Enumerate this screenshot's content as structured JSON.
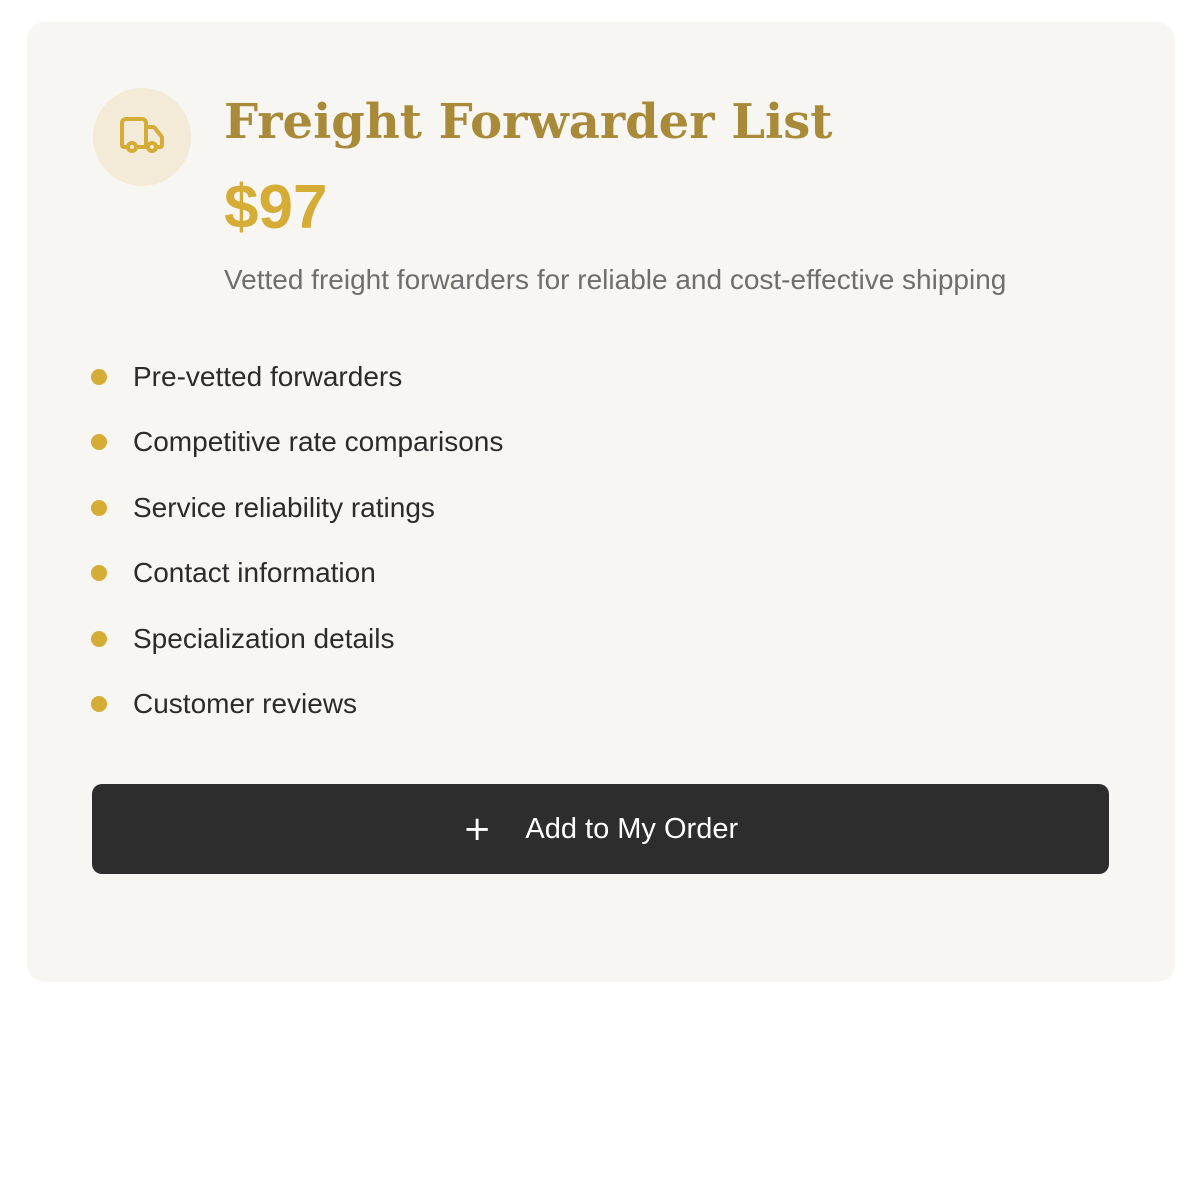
{
  "product": {
    "icon": "truck-icon",
    "title": "Freight Forwarder List",
    "price": "$97",
    "description": "Vetted freight forwarders for reliable and cost-effective shipping"
  },
  "features": [
    "Pre-vetted forwarders",
    "Competitive rate comparisons",
    "Service reliability ratings",
    "Contact information",
    "Specialization details",
    "Customer reviews"
  ],
  "cta": {
    "icon": "plus-icon",
    "plus_glyph": "+",
    "label": "Add to My Order"
  },
  "colors": {
    "accent": "#d4ac36",
    "title": "#a88a38",
    "card_background": "#f8f6f2",
    "icon_background": "#f3ead7",
    "button_background": "#2d2d2d",
    "button_text": "#ffffff"
  }
}
